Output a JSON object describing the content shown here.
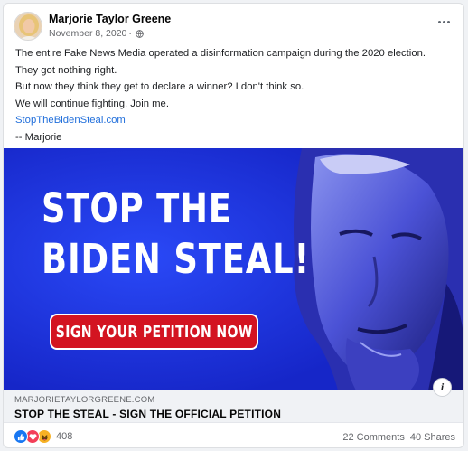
{
  "post": {
    "author": "Marjorie Taylor Greene",
    "date": "November 8, 2020",
    "separator": "·",
    "privacy_icon": "globe-icon",
    "more_icon": "more-options-icon",
    "lines": [
      "The entire Fake News Media operated a disinformation campaign during the 2020 election.",
      "They got nothing right.",
      "But now they think they get to declare a winner? I don't think so.",
      "We will continue fighting. Join me."
    ],
    "link_text": "StopTheBidenSteal.com",
    "signoff": "-- Marjorie"
  },
  "banner": {
    "line1": "STOP THE",
    "line2": "BIDEN STEAL!",
    "cta": "SIGN YOUR PETITION NOW",
    "info_label": "i",
    "colors": {
      "background": "#1b34e0",
      "cta": "#d31421"
    }
  },
  "link_preview": {
    "domain": "MARJORIETAYLORGREENE.COM",
    "title": "STOP THE STEAL - SIGN THE OFFICIAL PETITION"
  },
  "footer": {
    "reaction_icons": [
      "like-icon",
      "love-icon",
      "haha-icon"
    ],
    "reaction_count": "408",
    "comments": "22 Comments",
    "shares": "40 Shares"
  }
}
